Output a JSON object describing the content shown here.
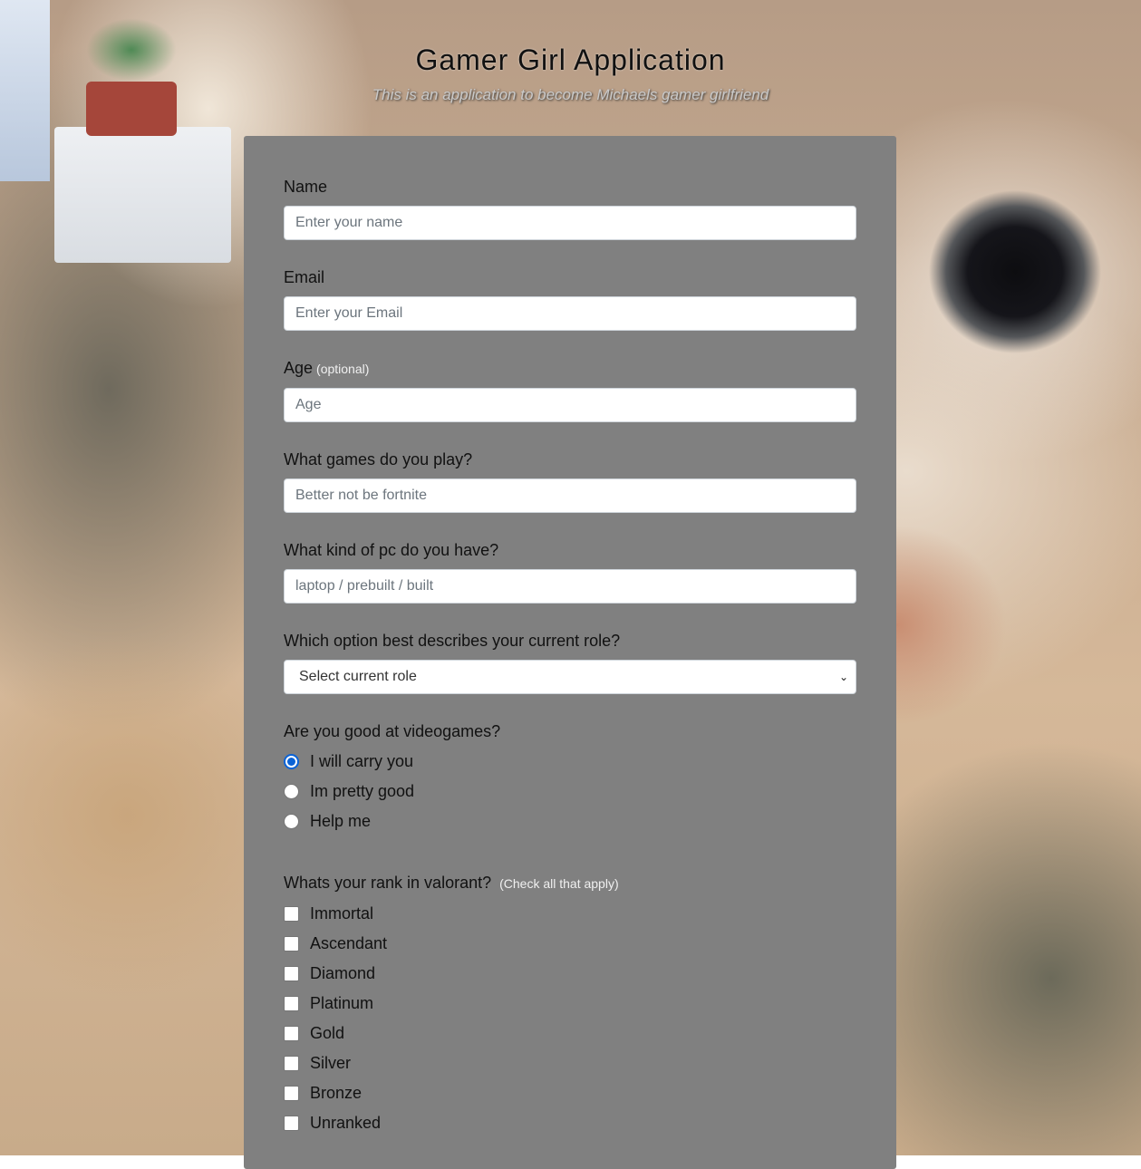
{
  "header": {
    "title": "Gamer Girl Application",
    "subtitle": "This is an application to become Michaels gamer girlfriend"
  },
  "form": {
    "name": {
      "label": "Name",
      "placeholder": "Enter your name"
    },
    "email": {
      "label": "Email",
      "placeholder": "Enter your Email"
    },
    "age": {
      "label": "Age",
      "optional": "(optional)",
      "placeholder": "Age"
    },
    "games": {
      "label": "What games do you play?",
      "placeholder": "Better not be fortnite"
    },
    "pc": {
      "label": "What kind of pc do you have?",
      "placeholder": "laptop / prebuilt / built"
    },
    "role": {
      "label": "Which option best describes your current role?",
      "selected": "Select current role"
    },
    "skill": {
      "label": "Are you good at videogames?",
      "options": [
        "I will carry you",
        "Im pretty good",
        "Help me"
      ],
      "checked_index": 0
    },
    "rank": {
      "label": "Whats your rank in valorant?",
      "hint": "(Check all that apply)",
      "options": [
        "Immortal",
        "Ascendant",
        "Diamond",
        "Platinum",
        "Gold",
        "Silver",
        "Bronze",
        "Unranked"
      ]
    }
  },
  "colors": {
    "card": "#808080",
    "radio_accent": "#0b63d6"
  }
}
